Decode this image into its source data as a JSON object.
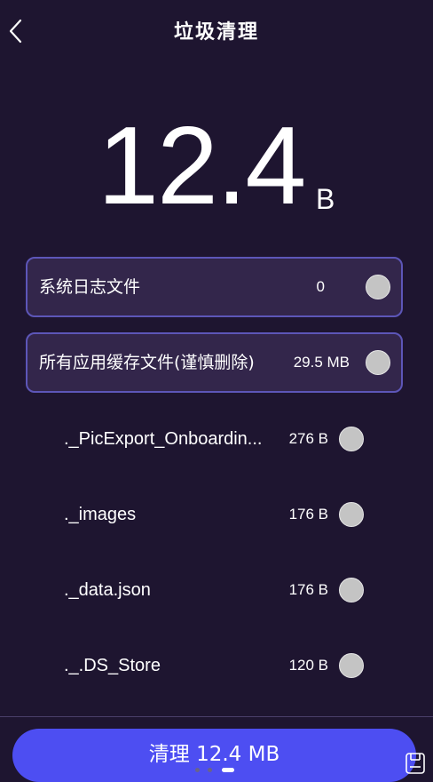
{
  "header": {
    "title": "垃圾清理"
  },
  "summary": {
    "size_value": "12.4",
    "size_unit": "B"
  },
  "categories": [
    {
      "label": "系统日志文件",
      "value": "0"
    },
    {
      "label": "所有应用缓存文件(谨慎删除)",
      "value": "29.5 MB"
    }
  ],
  "files": [
    {
      "name": "._PicExport_Onboardin...",
      "size": "276 B"
    },
    {
      "name": "._images",
      "size": "176 B"
    },
    {
      "name": "._data.json",
      "size": "176 B"
    },
    {
      "name": "._.DS_Store",
      "size": "120 B"
    }
  ],
  "footer": {
    "clean_button_label": "清理 12.4 MB"
  },
  "colors": {
    "background": "#1e1530",
    "card_background": "#33264b",
    "card_border": "#5d56b8",
    "accent": "#4d4ef2",
    "radio": "#c4c4c4"
  },
  "icons": {
    "back": "chevron-left-icon",
    "save": "save-icon"
  }
}
